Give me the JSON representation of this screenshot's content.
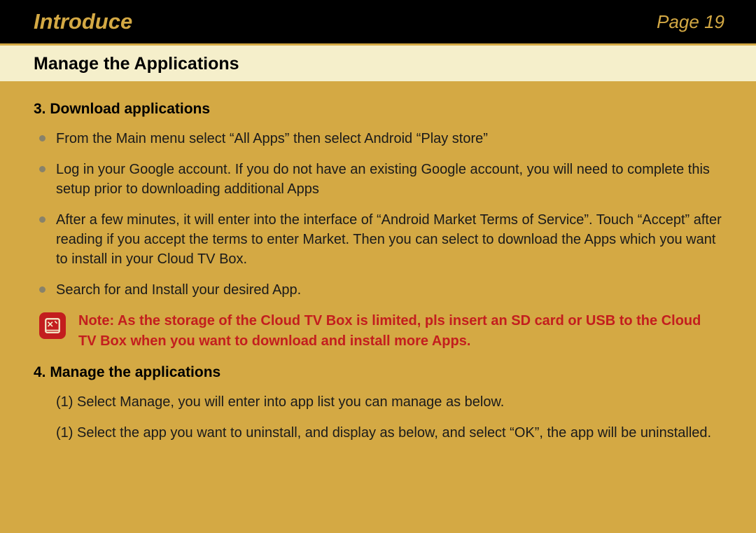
{
  "header": {
    "title": "Introduce",
    "page_label": "Page 19"
  },
  "subheader": {
    "title": "Manage the Applications"
  },
  "section3": {
    "heading": "3. Download applications",
    "bullets": [
      "From the Main menu select “All Apps” then select Android “Play store”",
      "Log in your Google account. If you do not have an existing Google account, you will need to complete this setup prior to downloading additional Apps",
      "After a few minutes, it will enter into the interface of “Android Market Terms of Service”. Touch “Accept” after reading if you accept the terms to enter Market. Then you can select to download the Apps which you want to install in your Cloud TV Box.",
      "Search for and Install your desired App."
    ]
  },
  "note": {
    "text": "Note: As the storage of the Cloud TV Box is limited, pls insert an SD card or USB to the Cloud TV Box when you want to download and install more Apps."
  },
  "section4": {
    "heading": "4. Manage the applications",
    "items": [
      "(1) Select Manage, you will enter into app list you can manage as below.",
      "(1) Select the app you want to uninstall, and display as below, and select “OK”, the app will be uninstalled."
    ]
  }
}
